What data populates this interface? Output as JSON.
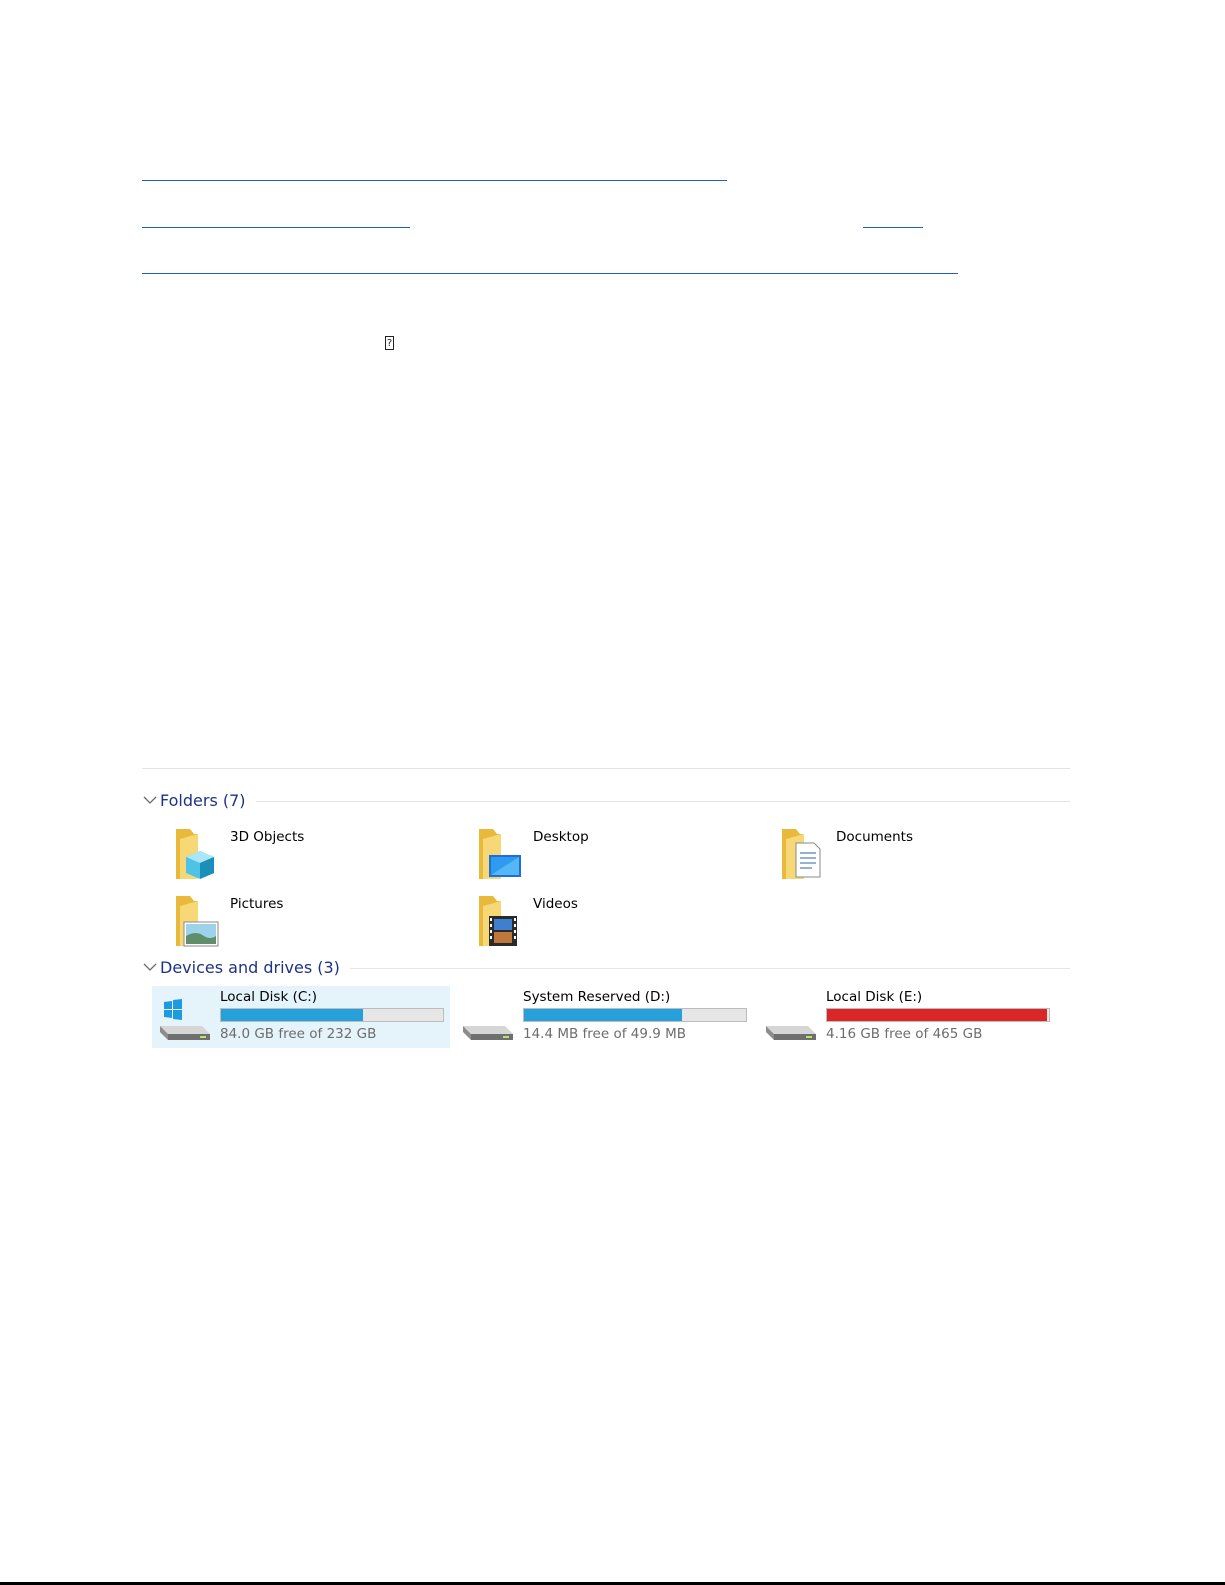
{
  "explorer": {
    "groups": [
      {
        "title": "Folders (7)"
      },
      {
        "title": "Devices and drives (3)"
      }
    ],
    "folders": [
      {
        "label": "3D Objects",
        "icon": "3d-objects-folder-icon"
      },
      {
        "label": "Desktop",
        "icon": "desktop-folder-icon"
      },
      {
        "label": "Documents",
        "icon": "documents-folder-icon"
      },
      {
        "label": "Pictures",
        "icon": "pictures-folder-icon"
      },
      {
        "label": "Videos",
        "icon": "videos-folder-icon"
      }
    ],
    "drives": [
      {
        "name": "Local Disk (C:)",
        "free_text": "84.0 GB free of 232 GB",
        "used_fraction": 0.638,
        "bar_color": "#26a0da",
        "selected": true,
        "icon": "windows-drive-icon"
      },
      {
        "name": "System Reserved (D:)",
        "free_text": "14.4 MB free of 49.9 MB",
        "used_fraction": 0.711,
        "bar_color": "#26a0da",
        "selected": false,
        "icon": "hard-drive-icon"
      },
      {
        "name": "Local Disk (E:)",
        "free_text": "4.16 GB free of 465 GB",
        "used_fraction": 0.991,
        "bar_color": "#da2626",
        "selected": false,
        "icon": "hard-drive-icon"
      }
    ]
  },
  "colors": {
    "link": "#1f5fbf",
    "header_text": "#1e3287",
    "selection": "#e5f3fb"
  }
}
